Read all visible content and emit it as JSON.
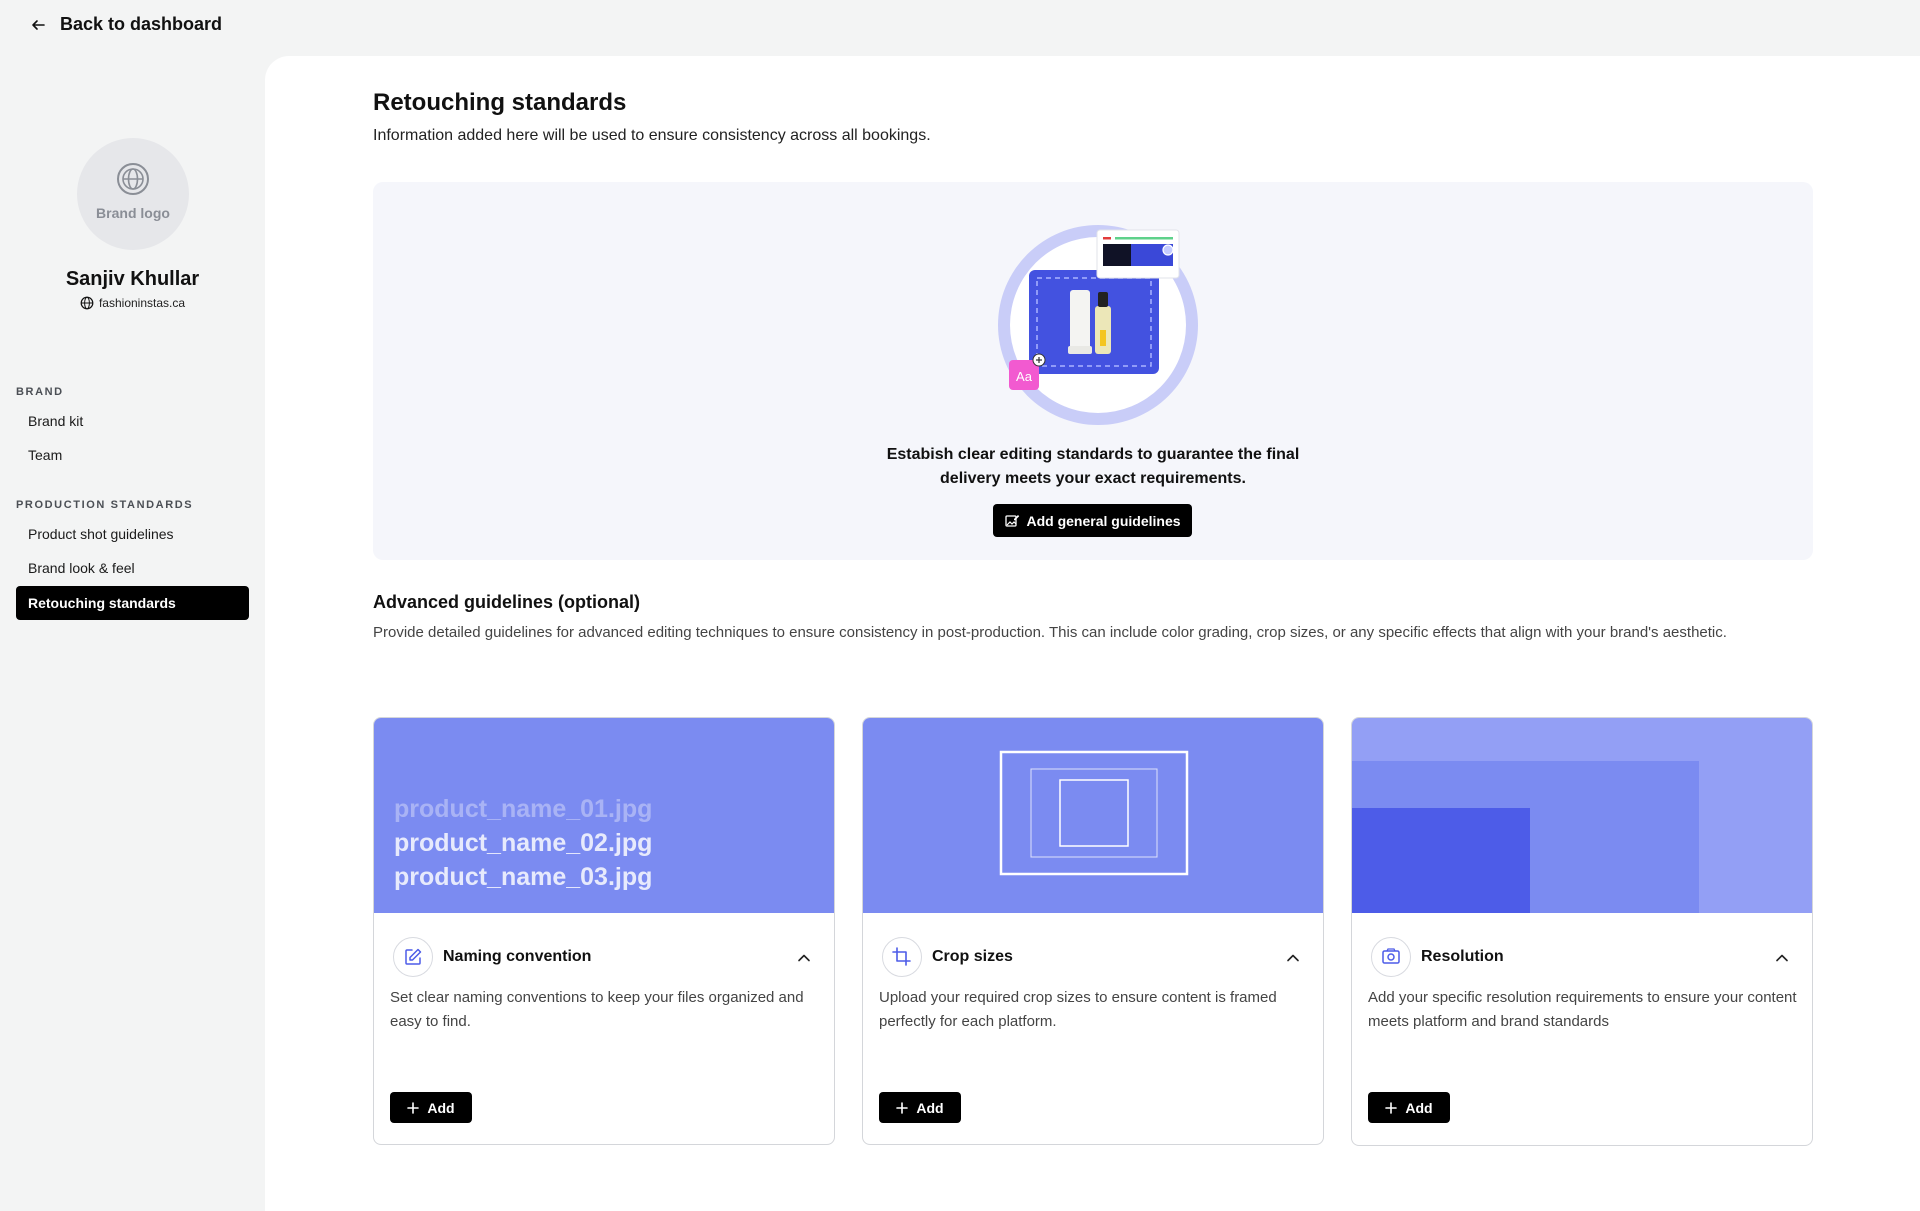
{
  "header": {
    "back_label": "Back to dashboard"
  },
  "profile": {
    "avatar_text": "Brand logo",
    "name": "Sanjiv Khullar",
    "website": "fashioninstas.ca"
  },
  "sidebar": {
    "sections": [
      {
        "title": "BRAND",
        "items": [
          "Brand kit",
          "Team"
        ]
      },
      {
        "title": "PRODUCTION STANDARDS",
        "items": [
          "Product shot guidelines",
          "Brand look & feel",
          "Retouching standards"
        ]
      }
    ],
    "active_item": "Retouching standards"
  },
  "page": {
    "title": "Retouching standards",
    "subtitle": "Information added here will be used to ensure consistency across all bookings."
  },
  "hero": {
    "text_line1": "Estabish clear editing standards to guarantee the final",
    "text_line2": "delivery meets your exact requirements.",
    "button_label": "Add general guidelines",
    "illustration_badge": "Aa"
  },
  "advanced": {
    "title": "Advanced guidelines (optional)",
    "description": "Provide detailed guidelines for advanced editing techniques to ensure consistency in post-production. This can include color grading, crop sizes, or any specific effects that align with your brand's aesthetic."
  },
  "cards": [
    {
      "title": "Naming convention",
      "icon": "edit-icon",
      "description": "Set clear naming conventions to keep your files organized and easy to find.",
      "add_label": "Add",
      "filenames": [
        "product_name_01.jpg",
        "product_name_02.jpg",
        "product_name_03.jpg"
      ]
    },
    {
      "title": "Crop sizes",
      "icon": "crop-icon",
      "description": "Upload your required crop sizes to ensure content is framed perfectly for each platform.",
      "add_label": "Add"
    },
    {
      "title": "Resolution",
      "icon": "resolution-icon",
      "description": "Add your specific resolution requirements to ensure your content meets platform and brand standards",
      "add_label": "Add"
    }
  ],
  "colors": {
    "accent": "#7b8bf1",
    "accent_dark": "#4d5ce8",
    "accent_light": "#939ff5",
    "primary_button": "#000000"
  }
}
